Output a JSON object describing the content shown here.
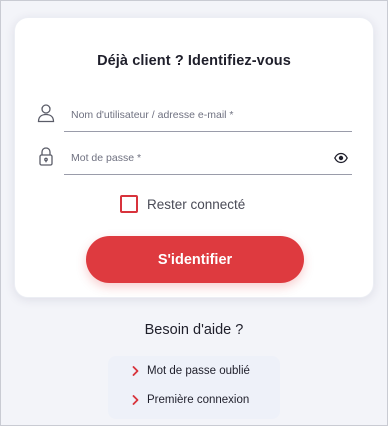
{
  "login": {
    "title": "Déjà client ? Identifiez-vous",
    "username_placeholder": "Nom d'utilisateur / adresse e-mail *",
    "password_placeholder": "Mot de passe *",
    "remember_label": "Rester connecté",
    "submit_label": "S'identifier"
  },
  "help": {
    "title": "Besoin d'aide ?",
    "links": [
      {
        "label": "Mot de passe oublié"
      },
      {
        "label": "Première connexion"
      }
    ]
  },
  "icons": {
    "username": "user-icon",
    "password": "padlock-icon",
    "toggle_password": "eye-icon",
    "link_arrow": "chevron-right-icon"
  },
  "colors": {
    "accent": "#de3a3f",
    "background": "#f3f4f9",
    "help_box": "#eef1f9"
  }
}
